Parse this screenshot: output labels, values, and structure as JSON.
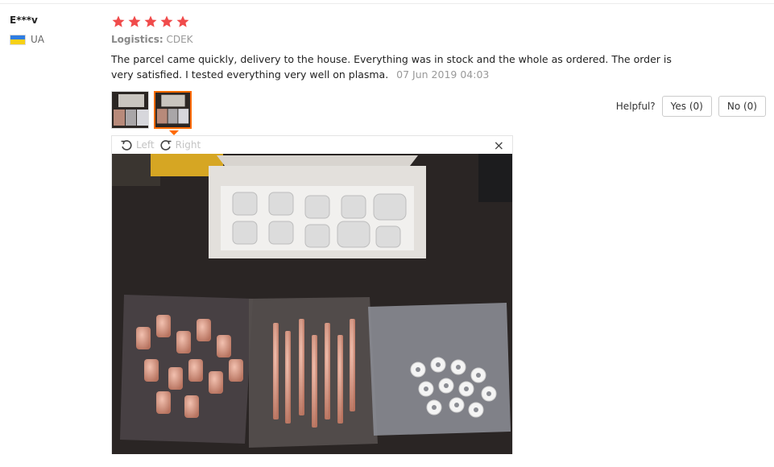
{
  "review": {
    "user_name": "E***v",
    "country": "UA",
    "rating": 5,
    "logistics_label": "Logistics:",
    "logistics_value": "CDEK",
    "text": "The parcel came quickly, delivery to the house. Everything was in stock and the whole as ordered. The order is very satisfied. I tested everything very well on plasma.",
    "date": "07 Jun 2019 04:03"
  },
  "helpful": {
    "label": "Helpful?",
    "yes_label": "Yes (0)",
    "no_label": "No (0)"
  },
  "viewer": {
    "rotate_left_label": "Left",
    "rotate_right_label": "Right",
    "close_glyph": "×"
  },
  "colors": {
    "star": "#f04b4b",
    "accent": "#ff6a00",
    "flag_top": "#2f7de1",
    "flag_bottom": "#f7d117"
  },
  "icons": [
    "star-icon",
    "flag-icon",
    "rotate-left-icon",
    "rotate-right-icon",
    "close-icon"
  ]
}
